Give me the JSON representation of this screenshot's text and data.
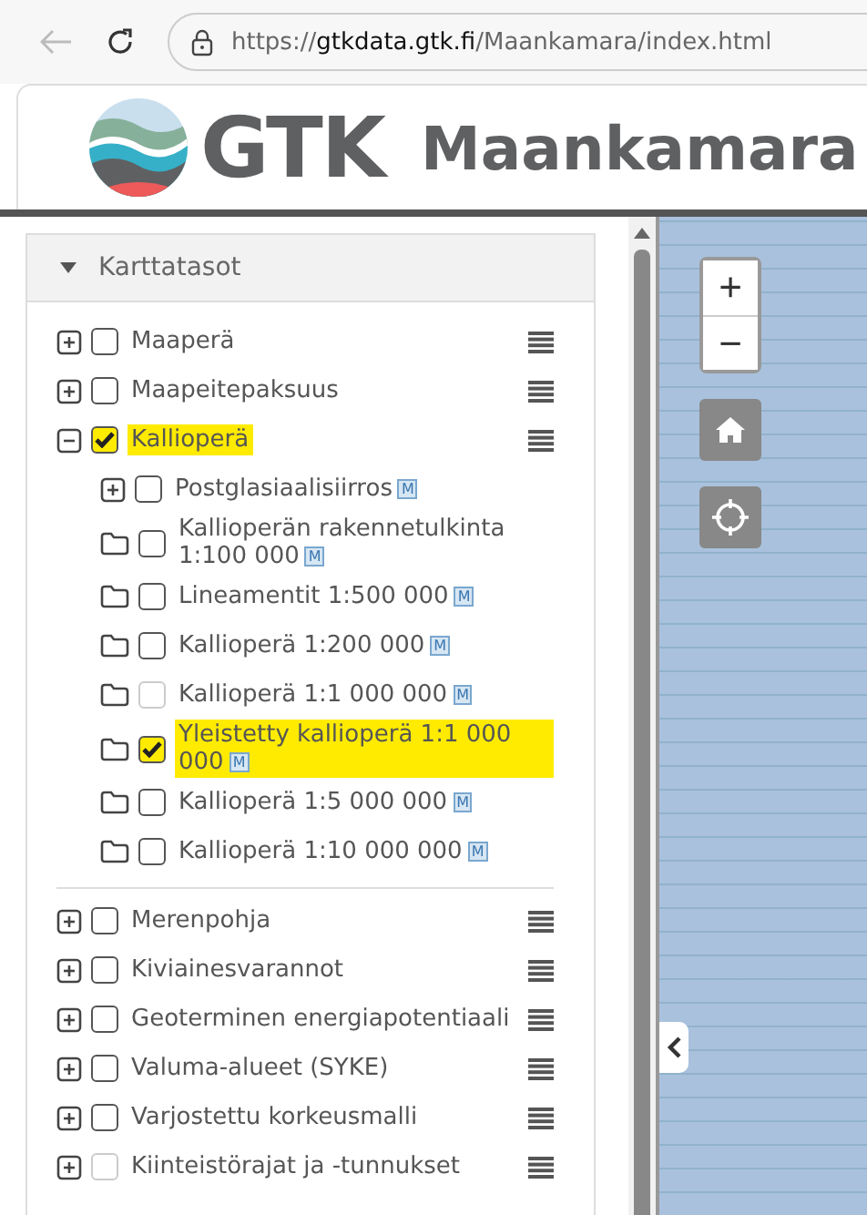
{
  "browser": {
    "url_scheme": "https://",
    "url_host": "gtkdata.gtk.fi",
    "url_path": "/Maankamara/index.html"
  },
  "header": {
    "logo_text": "GTK",
    "title": "Maankamara"
  },
  "panel": {
    "title": "Karttatasot",
    "expanded": true
  },
  "layers": [
    {
      "label": "Maaperä",
      "kind": "plus",
      "checked": false,
      "disabled": false,
      "highlighted": false
    },
    {
      "label": "Maapeitepaksuus",
      "kind": "plus",
      "checked": false,
      "disabled": false,
      "highlighted": false
    },
    {
      "label": "Kallioperä",
      "kind": "minus",
      "checked": true,
      "disabled": false,
      "highlighted": true,
      "children": [
        {
          "label": "Postglasiaalisiirros",
          "badge": "M",
          "kind": "plus",
          "checked": false,
          "disabled": false,
          "highlighted": false
        },
        {
          "label": "Kallioperän rakennetulkinta 1:100 000",
          "badge": "M",
          "kind": "folder",
          "checked": false,
          "disabled": false,
          "highlighted": false
        },
        {
          "label": "Lineamentit 1:500 000",
          "badge": "M",
          "kind": "folder",
          "checked": false,
          "disabled": false,
          "highlighted": false
        },
        {
          "label": "Kallioperä 1:200 000",
          "badge": "M",
          "kind": "folder",
          "checked": false,
          "disabled": false,
          "highlighted": false
        },
        {
          "label": "Kallioperä 1:1 000 000",
          "badge": "M",
          "kind": "folder",
          "checked": false,
          "disabled": true,
          "highlighted": false
        },
        {
          "label": "Yleistetty kallioperä 1:1 000 000",
          "badge": "M",
          "kind": "folder",
          "checked": true,
          "disabled": false,
          "highlighted": true
        },
        {
          "label": "Kallioperä 1:5 000 000",
          "badge": "M",
          "kind": "folder",
          "checked": false,
          "disabled": false,
          "highlighted": false
        },
        {
          "label": "Kallioperä 1:10 000 000",
          "badge": "M",
          "kind": "folder",
          "checked": false,
          "disabled": false,
          "highlighted": false
        }
      ]
    },
    {
      "label": "Merenpohja",
      "kind": "plus",
      "checked": false,
      "disabled": false,
      "highlighted": false
    },
    {
      "label": "Kiviainesvarannot",
      "kind": "plus",
      "checked": false,
      "disabled": false,
      "highlighted": false
    },
    {
      "label": "Geoterminen energiapotentiaali",
      "kind": "plus",
      "checked": false,
      "disabled": false,
      "highlighted": false
    },
    {
      "label": "Valuma-alueet (SYKE)",
      "kind": "plus",
      "checked": false,
      "disabled": false,
      "highlighted": false
    },
    {
      "label": "Varjostettu korkeusmalli",
      "kind": "plus",
      "checked": false,
      "disabled": false,
      "highlighted": false
    },
    {
      "label": "Kiinteistörajat ja -tunnukset",
      "kind": "plus",
      "checked": false,
      "disabled": true,
      "highlighted": false
    }
  ],
  "map_controls": {
    "zoom_in": "+",
    "zoom_out": "−"
  }
}
